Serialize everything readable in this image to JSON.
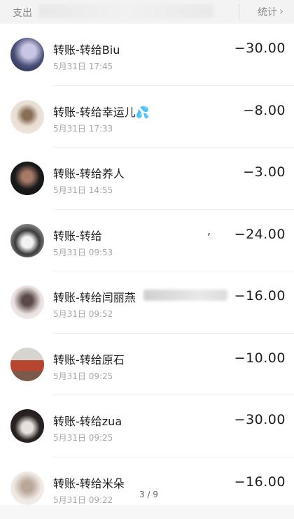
{
  "header": {
    "left_label": "支出",
    "right_label": "统计",
    "chevron_icon": "chevron-right-icon"
  },
  "transactions": [
    {
      "title": "转账-转给Biu",
      "time": "5月31日 17:45",
      "amount": "−30.00",
      "avatar_colors": [
        "#4a4f79",
        "#c9c6e3"
      ]
    },
    {
      "title": "转账-转给幸运儿💦",
      "time": "5月31日 17:33",
      "amount": "−8.00",
      "avatar_colors": [
        "#e7ddd2",
        "#8a6f57"
      ]
    },
    {
      "title": "转账-转给养人",
      "time": "5月31日 14:55",
      "amount": "−3.00",
      "avatar_colors": [
        "#1b1b1b",
        "#a87a66"
      ]
    },
    {
      "title": "转账-转给",
      "time": "5月31日 09:53",
      "amount": "−24.00",
      "avatar_colors": [
        "#d8d8d8",
        "#3b3b3b"
      ],
      "extra": ","
    },
    {
      "title": "转账-转给闫丽燕",
      "time": "5月31日 09:52",
      "amount": "−16.00",
      "avatar_colors": [
        "#e9e1e0",
        "#5b4b47"
      ]
    },
    {
      "title": "转账-转给原石",
      "time": "5月31日 09:25",
      "amount": "−10.00",
      "avatar_colors": [
        "#b8452f",
        "#d7d4cf"
      ]
    },
    {
      "title": "转账-转给zua",
      "time": "5月31日 09:25",
      "amount": "−30.00",
      "avatar_colors": [
        "#2a2423",
        "#e7e1dc"
      ]
    },
    {
      "title": "转账-转给米朵",
      "time": "5月31日 09:22",
      "amount": "−16.00",
      "avatar_colors": [
        "#efe8e3",
        "#b9a79a"
      ]
    }
  ],
  "pager": "3 / 9"
}
